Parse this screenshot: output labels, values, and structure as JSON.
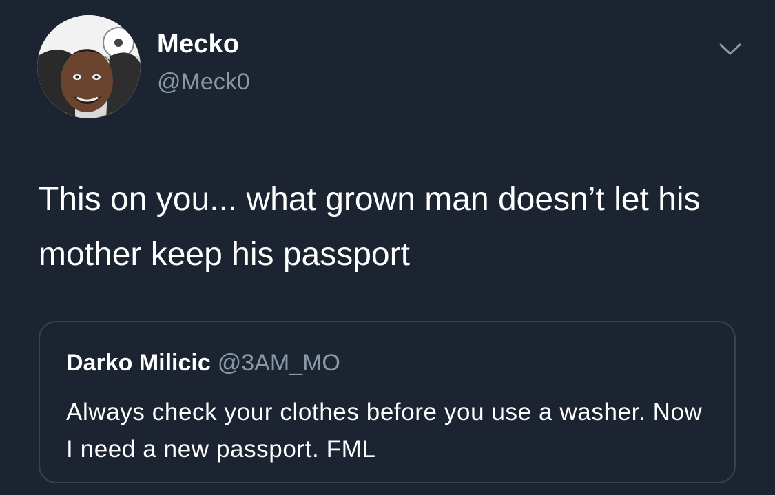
{
  "tweet": {
    "author": {
      "name": "Mecko",
      "handle": "@Meck0",
      "avatar_icon": "profile-photo"
    },
    "menu_icon": "chevron-down-icon",
    "text": "This on you... what grown man doesn’t let his mother keep his passport",
    "quoted": {
      "name": "Darko Milicic",
      "handle": "@3AM_MO",
      "text": "Always check your clothes before you use a washer. Now I need a new passport. FML"
    }
  },
  "colors": {
    "background": "#1c2432",
    "primary_text": "#ffffff",
    "secondary_text": "#8899a6",
    "border": "#38444d"
  }
}
